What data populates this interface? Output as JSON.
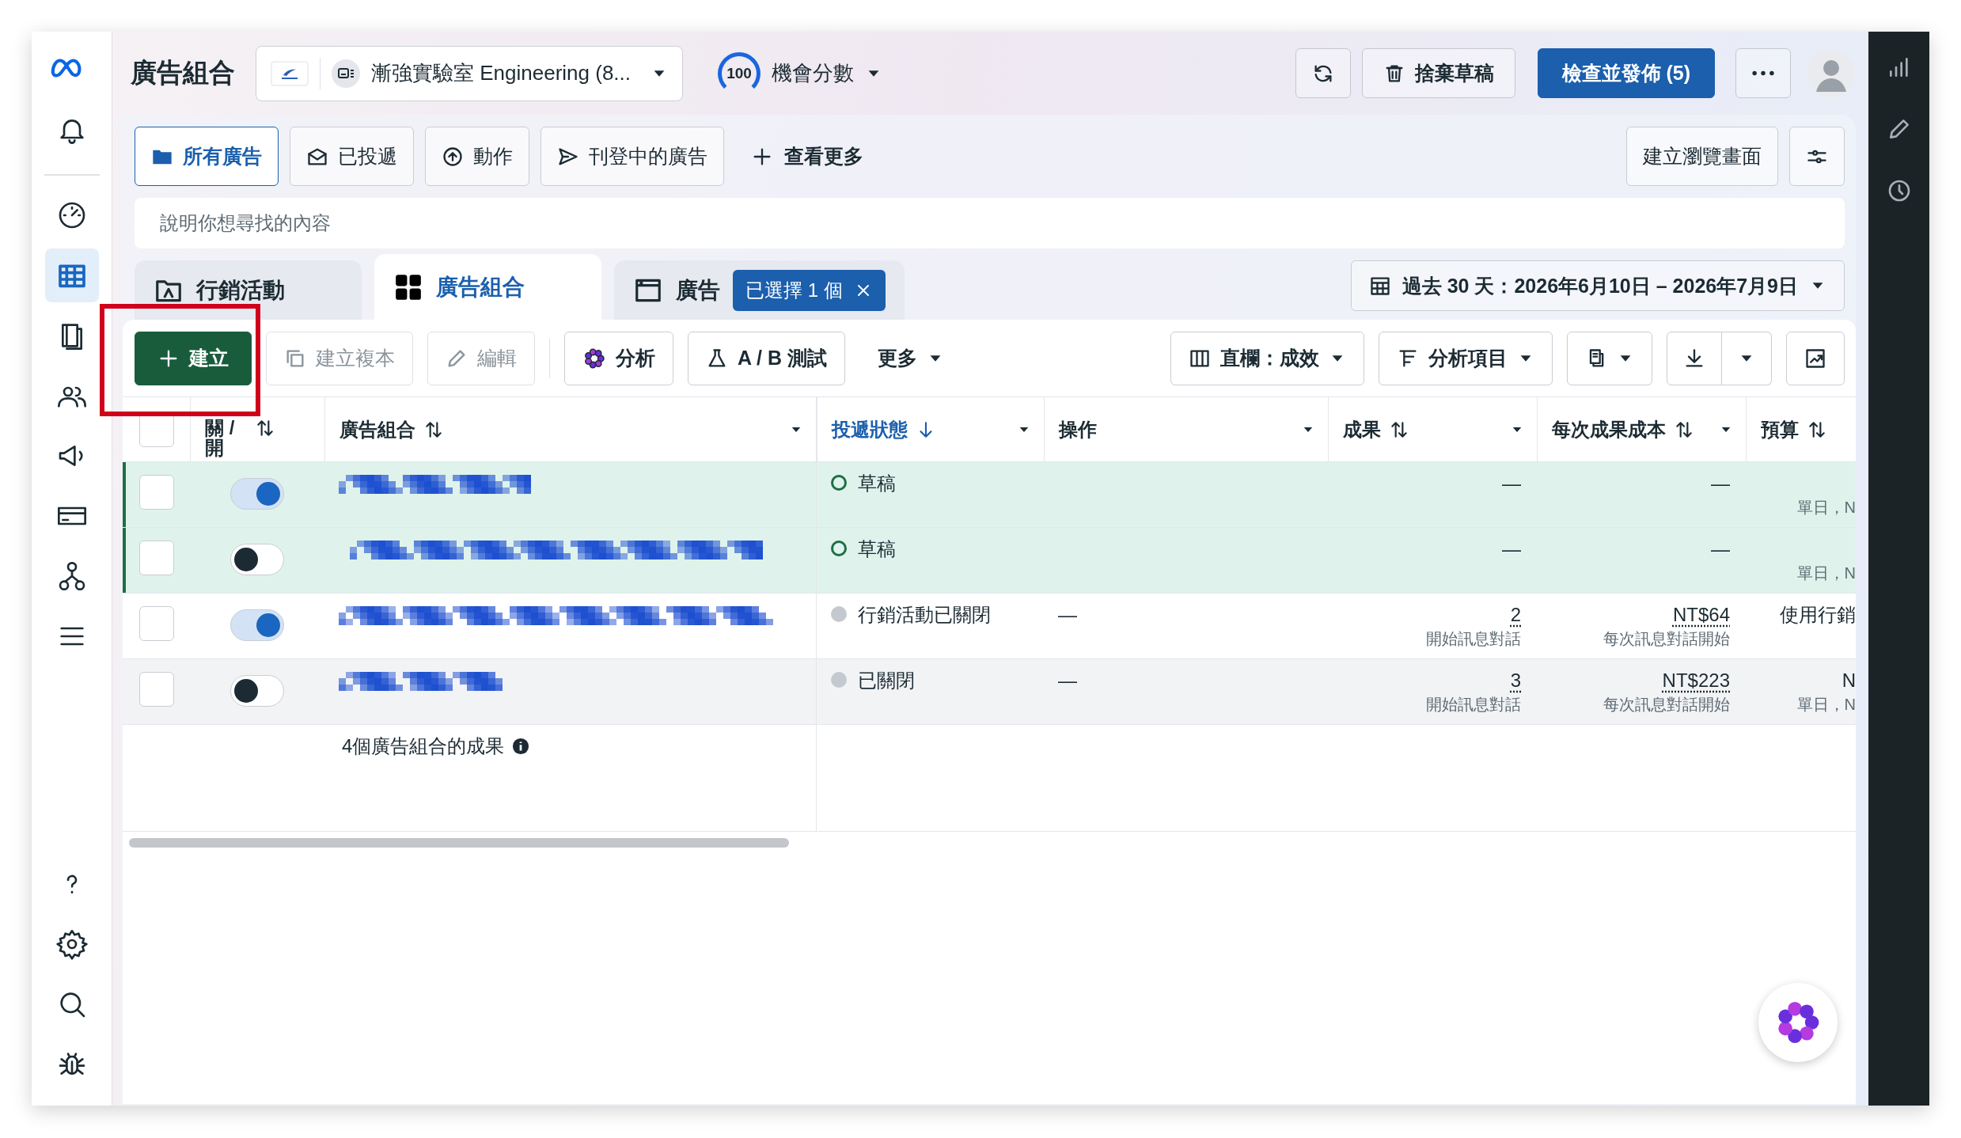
{
  "header": {
    "title": "廣告組合",
    "account": "漸強實驗室 Engineering (8...",
    "score": "100",
    "score_label": "機會分數",
    "discard": "捨棄草稿",
    "publish": "檢查並發佈 (5)"
  },
  "sidebar": {
    "items": [
      {
        "selected": false
      },
      {
        "selected": false
      },
      {
        "selected": true
      },
      {
        "selected": false
      },
      {
        "selected": false
      },
      {
        "selected": false
      },
      {
        "selected": false
      },
      {
        "selected": false
      },
      {
        "selected": false
      }
    ]
  },
  "filters": {
    "items": [
      {
        "label": "所有廣告",
        "selected": true
      },
      {
        "label": "已投遞",
        "selected": false
      },
      {
        "label": "動作",
        "selected": false
      },
      {
        "label": "刊登中的廣告",
        "selected": false
      }
    ],
    "more": "查看更多",
    "create_view": "建立瀏覽畫面"
  },
  "search": {
    "placeholder": "說明你想尋找的內容"
  },
  "levels": {
    "tabs": [
      {
        "label": "行銷活動",
        "selected": false
      },
      {
        "label": "廣告組合",
        "selected": true
      },
      {
        "label": "廣告",
        "selected": false,
        "chip": "已選擇 1 個"
      }
    ],
    "date_range": "過去 30 天：2026年6月10日 – 2026年7月9日"
  },
  "toolbar": {
    "left": [
      {
        "label": "建立",
        "kind": "primary",
        "disabled": false
      },
      {
        "label": "建立複本",
        "kind": "button",
        "disabled": true
      },
      {
        "label": "編輯",
        "kind": "button",
        "disabled": true
      },
      {
        "label": "分析",
        "kind": "button",
        "disabled": false
      },
      {
        "label": "A / B 測試",
        "kind": "button",
        "disabled": false
      },
      {
        "label": "更多",
        "kind": "menu",
        "disabled": false
      }
    ],
    "right": [
      {
        "label": "直欄：成效"
      },
      {
        "label": "分析項目"
      }
    ]
  },
  "table": {
    "columns": [
      {
        "label": "關 / 開",
        "sortable": true,
        "sorted": false,
        "menu": false
      },
      {
        "label": "廣告組合",
        "sortable": true,
        "sorted": false,
        "menu": true
      },
      {
        "label": "投遞狀態",
        "sortable": true,
        "sorted": true,
        "menu": true
      },
      {
        "label": "操作",
        "sortable": false,
        "sorted": false,
        "menu": true
      },
      {
        "label": "成果",
        "sortable": true,
        "sorted": false,
        "menu": true
      },
      {
        "label": "每次成果成本",
        "sortable": true,
        "sorted": false,
        "menu": true
      },
      {
        "label": "預算",
        "sortable": true,
        "sorted": false,
        "menu": false
      }
    ],
    "header_checked": false,
    "rows": [
      {
        "checked": false,
        "on": true,
        "highlighted": true,
        "hovered": false,
        "status": "草稿",
        "kind": "draft",
        "result": "—",
        "cost": "—",
        "budget_note": "單日，N"
      },
      {
        "checked": false,
        "on": false,
        "highlighted": true,
        "hovered": false,
        "status": "草稿",
        "kind": "draft",
        "result": "—",
        "cost": "—",
        "budget_note": "單日，N"
      },
      {
        "checked": false,
        "on": true,
        "highlighted": false,
        "hovered": false,
        "status": "行銷活動已關閉",
        "kind": "off",
        "action": "—",
        "result": "2",
        "result_note": "開始訊息對話",
        "cost": "NT$64",
        "cost_note": "每次訊息對話開始",
        "budget": "使用行銷"
      },
      {
        "checked": false,
        "on": false,
        "highlighted": false,
        "hovered": true,
        "status": "已關閉",
        "kind": "off",
        "action": "—",
        "result": "3",
        "result_note": "開始訊息對話",
        "cost": "NT$223",
        "cost_note": "每次訊息對話開始",
        "budget": "N",
        "budget_note": "單日，N"
      }
    ],
    "summary": "4個廣告組合的成果"
  }
}
